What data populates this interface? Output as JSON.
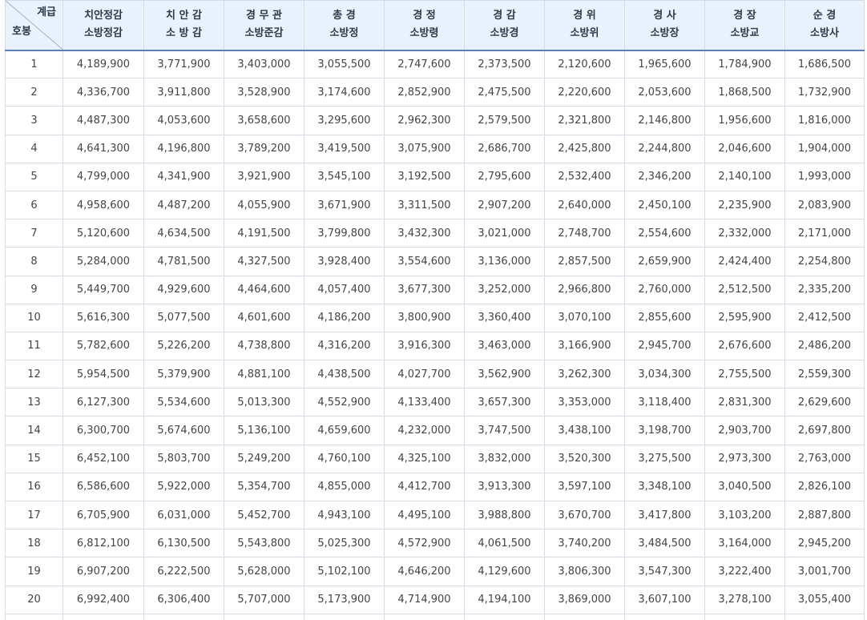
{
  "table": {
    "corner_top": "계급",
    "corner_bottom": "호봉",
    "columns": [
      {
        "line1": "치안정감",
        "line2": "소방정감"
      },
      {
        "line1": "치 안 감",
        "line2": "소 방 감"
      },
      {
        "line1": "경 무 관",
        "line2": "소방준감"
      },
      {
        "line1": "총 경",
        "line2": "소방정"
      },
      {
        "line1": "경 정",
        "line2": "소방령"
      },
      {
        "line1": "경 감",
        "line2": "소방경"
      },
      {
        "line1": "경 위",
        "line2": "소방위"
      },
      {
        "line1": "경 사",
        "line2": "소방장"
      },
      {
        "line1": "경 장",
        "line2": "소방교"
      },
      {
        "line1": "순 경",
        "line2": "소방사"
      }
    ],
    "rows": [
      [
        "1",
        "4,189,900",
        "3,771,900",
        "3,403,000",
        "3,055,500",
        "2,747,600",
        "2,373,500",
        "2,120,600",
        "1,965,600",
        "1,784,900",
        "1,686,500"
      ],
      [
        "2",
        "4,336,700",
        "3,911,800",
        "3,528,900",
        "3,174,600",
        "2,852,900",
        "2,475,500",
        "2,220,600",
        "2,053,600",
        "1,868,500",
        "1,732,900"
      ],
      [
        "3",
        "4,487,300",
        "4,053,600",
        "3,658,600",
        "3,295,600",
        "2,962,300",
        "2,579,500",
        "2,321,800",
        "2,146,800",
        "1,956,600",
        "1,816,000"
      ],
      [
        "4",
        "4,641,300",
        "4,196,800",
        "3,789,200",
        "3,419,500",
        "3,075,900",
        "2,686,700",
        "2,425,800",
        "2,244,800",
        "2,046,600",
        "1,904,000"
      ],
      [
        "5",
        "4,799,000",
        "4,341,900",
        "3,921,900",
        "3,545,100",
        "3,192,500",
        "2,795,600",
        "2,532,400",
        "2,346,200",
        "2,140,100",
        "1,993,000"
      ],
      [
        "6",
        "4,958,600",
        "4,487,200",
        "4,055,900",
        "3,671,900",
        "3,311,500",
        "2,907,200",
        "2,640,000",
        "2,450,100",
        "2,235,900",
        "2,083,900"
      ],
      [
        "7",
        "5,120,600",
        "4,634,500",
        "4,191,500",
        "3,799,800",
        "3,432,300",
        "3,021,000",
        "2,748,700",
        "2,554,600",
        "2,332,000",
        "2,171,000"
      ],
      [
        "8",
        "5,284,000",
        "4,781,500",
        "4,327,500",
        "3,928,400",
        "3,554,600",
        "3,136,000",
        "2,857,500",
        "2,659,900",
        "2,424,400",
        "2,254,800"
      ],
      [
        "9",
        "5,449,700",
        "4,929,600",
        "4,464,600",
        "4,057,400",
        "3,677,300",
        "3,252,000",
        "2,966,800",
        "2,760,000",
        "2,512,500",
        "2,335,200"
      ],
      [
        "10",
        "5,616,300",
        "5,077,500",
        "4,601,600",
        "4,186,200",
        "3,800,900",
        "3,360,400",
        "3,070,100",
        "2,855,600",
        "2,595,900",
        "2,412,500"
      ],
      [
        "11",
        "5,782,600",
        "5,226,200",
        "4,738,800",
        "4,316,200",
        "3,916,300",
        "3,463,000",
        "3,166,900",
        "2,945,700",
        "2,676,600",
        "2,486,200"
      ],
      [
        "12",
        "5,954,500",
        "5,379,900",
        "4,881,100",
        "4,438,500",
        "4,027,700",
        "3,562,900",
        "3,262,300",
        "3,034,300",
        "2,755,500",
        "2,559,300"
      ],
      [
        "13",
        "6,127,300",
        "5,534,600",
        "5,013,300",
        "4,552,900",
        "4,133,400",
        "3,657,300",
        "3,353,000",
        "3,118,400",
        "2,831,300",
        "2,629,600"
      ],
      [
        "14",
        "6,300,700",
        "5,674,600",
        "5,136,100",
        "4,659,600",
        "4,232,000",
        "3,747,500",
        "3,438,100",
        "3,198,700",
        "2,903,700",
        "2,697,800"
      ],
      [
        "15",
        "6,452,100",
        "5,803,700",
        "5,249,200",
        "4,760,100",
        "4,325,100",
        "3,832,000",
        "3,520,300",
        "3,275,500",
        "2,973,300",
        "2,763,000"
      ],
      [
        "16",
        "6,586,600",
        "5,922,000",
        "5,354,700",
        "4,855,000",
        "4,412,700",
        "3,913,300",
        "3,597,100",
        "3,348,100",
        "3,040,500",
        "2,826,100"
      ],
      [
        "17",
        "6,705,900",
        "6,031,000",
        "5,452,700",
        "4,943,100",
        "4,495,100",
        "3,988,800",
        "3,670,700",
        "3,417,800",
        "3,103,200",
        "2,887,800"
      ],
      [
        "18",
        "6,812,100",
        "6,130,500",
        "5,543,800",
        "5,025,300",
        "4,572,900",
        "4,061,500",
        "3,740,200",
        "3,484,500",
        "3,164,000",
        "2,945,200"
      ],
      [
        "19",
        "6,907,200",
        "6,222,500",
        "5,628,000",
        "5,102,100",
        "4,646,200",
        "4,129,600",
        "3,806,300",
        "3,547,300",
        "3,222,400",
        "3,001,700"
      ],
      [
        "20",
        "6,992,400",
        "6,306,400",
        "5,707,000",
        "5,173,900",
        "4,714,900",
        "4,194,100",
        "3,869,000",
        "3,607,100",
        "3,278,100",
        "3,055,400"
      ]
    ]
  },
  "colors": {
    "header_bg": "#e8f1fc",
    "header_border": "#5b7fb6",
    "grid": "#d6dce4"
  }
}
